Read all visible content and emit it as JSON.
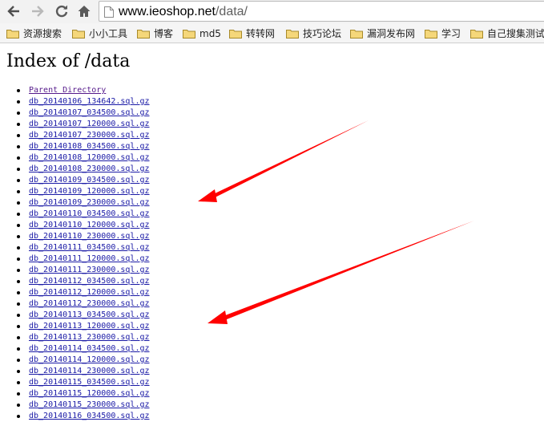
{
  "browser": {
    "url_host": "www.ieoshop.net",
    "url_path": "/data/",
    "bookmarks": [
      "资源搜索",
      "小小工具",
      "博客",
      "md5",
      "转转网",
      "技巧论坛",
      "漏洞发布网",
      "学习",
      "自己搜集测试"
    ]
  },
  "page": {
    "title": "Index of /data",
    "parent_link": "Parent Directory",
    "files": [
      "db_20140106_134642.sql.gz",
      "db_20140107_034500.sql.gz",
      "db_20140107_120000.sql.gz",
      "db_20140107_230000.sql.gz",
      "db_20140108_034500.sql.gz",
      "db_20140108_120000.sql.gz",
      "db_20140108_230000.sql.gz",
      "db_20140109_034500.sql.gz",
      "db_20140109_120000.sql.gz",
      "db_20140109_230000.sql.gz",
      "db_20140110_034500.sql.gz",
      "db_20140110_120000.sql.gz",
      "db_20140110_230000.sql.gz",
      "db_20140111_034500.sql.gz",
      "db_20140111_120000.sql.gz",
      "db_20140111_230000.sql.gz",
      "db_20140112_034500.sql.gz",
      "db_20140112_120000.sql.gz",
      "db_20140112_230000.sql.gz",
      "db_20140113_034500.sql.gz",
      "db_20140113_120000.sql.gz",
      "db_20140113_230000.sql.gz",
      "db_20140114_034500.sql.gz",
      "db_20140114_120000.sql.gz",
      "db_20140114_230000.sql.gz",
      "db_20140115_034500.sql.gz",
      "db_20140115_120000.sql.gz",
      "db_20140115_230000.sql.gz",
      "db_20140116_034500.sql.gz"
    ]
  },
  "colors": {
    "link": "#1a1aa6",
    "visited_link": "#551a8b",
    "annotation_arrow": "#ff0000"
  }
}
